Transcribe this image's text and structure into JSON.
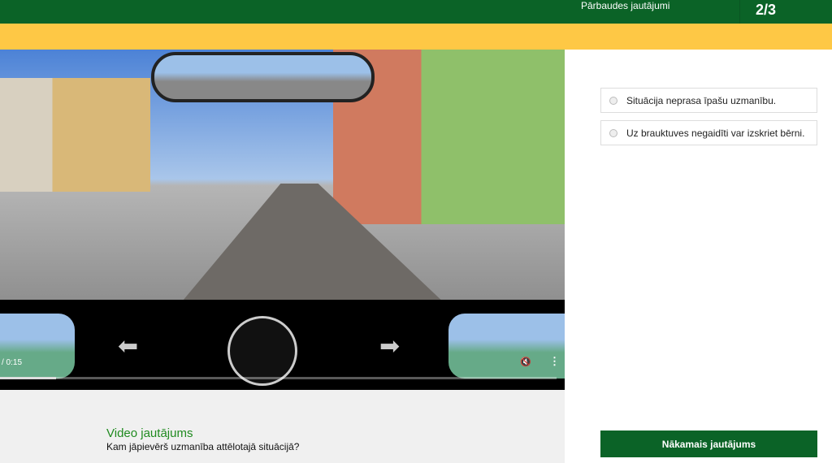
{
  "header": {
    "title": "Pārbaudes jautājumi",
    "progress": "2/3"
  },
  "video": {
    "time": "/ 0:15",
    "progress_percent": 10,
    "mute_icon": "muted-speaker-icon",
    "menu_icon": "more-vertical-icon"
  },
  "question": {
    "type": "Video jautājums",
    "text": "Kam jāpievērš uzmanība attēlotajā situācijā?"
  },
  "answers": [
    {
      "label": "Situācija neprasa īpašu uzmanību."
    },
    {
      "label": "Uz brauktuves negaidīti var izskriet bērni."
    }
  ],
  "next_button": "Nākamais jautājums",
  "colors": {
    "brand_green": "#0b6327",
    "accent_yellow": "#fec845"
  }
}
